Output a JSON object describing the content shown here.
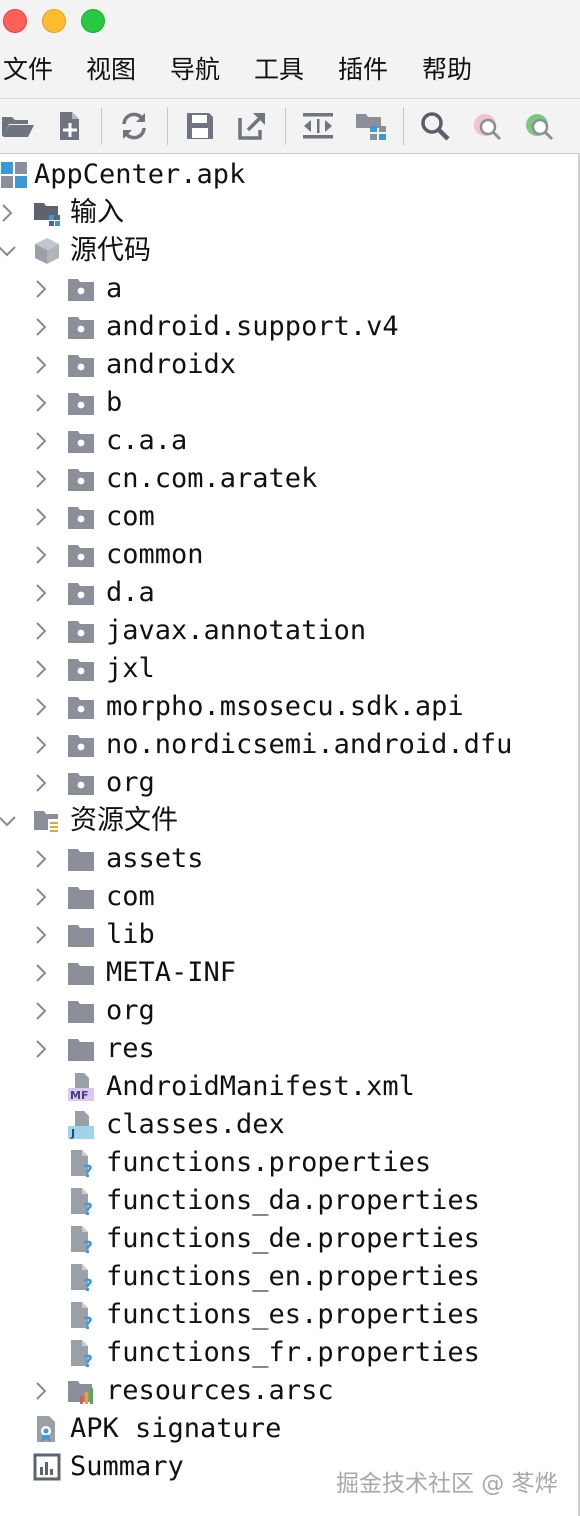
{
  "menu": [
    "文件",
    "视图",
    "导航",
    "工具",
    "插件",
    "帮助"
  ],
  "toolbar": {
    "icons": [
      "open-folder-icon",
      "add-file-icon",
      "sync-icon",
      "save-icon",
      "export-icon",
      "navigate-icon",
      "package-icon",
      "search-icon",
      "find-usage-icon",
      "find-class-icon"
    ]
  },
  "tree": {
    "root": "AppCenter.apk",
    "input": "输入",
    "source_code": "源代码",
    "packages": [
      "a",
      "android.support.v4",
      "androidx",
      "b",
      "c.a.a",
      "cn.com.aratek",
      "com",
      "common",
      "d.a",
      "javax.annotation",
      "jxl",
      "morpho.msosecu.sdk.api",
      "no.nordicsemi.android.dfu",
      "org"
    ],
    "resources": "资源文件",
    "resource_folders": [
      "assets",
      "com",
      "lib",
      "META-INF",
      "org",
      "res"
    ],
    "manifest": "AndroidManifest.xml",
    "manifest_badge": "MF",
    "dex": "classes.dex",
    "dex_badge": "J",
    "properties": [
      "functions.properties",
      "functions_da.properties",
      "functions_de.properties",
      "functions_en.properties",
      "functions_es.properties",
      "functions_fr.properties"
    ],
    "arsc": "resources.arsc",
    "apk_signature": "APK signature",
    "summary": "Summary"
  },
  "watermark": "掘金技术社区 @ 苳烨",
  "colors": {
    "chrome_bg": "#f3f3f3",
    "folder_gray": "#8a8f99",
    "package_dot": "#ffffff",
    "accent_blue": "#3a9ad9",
    "manifest_purple": "#b89be0"
  }
}
